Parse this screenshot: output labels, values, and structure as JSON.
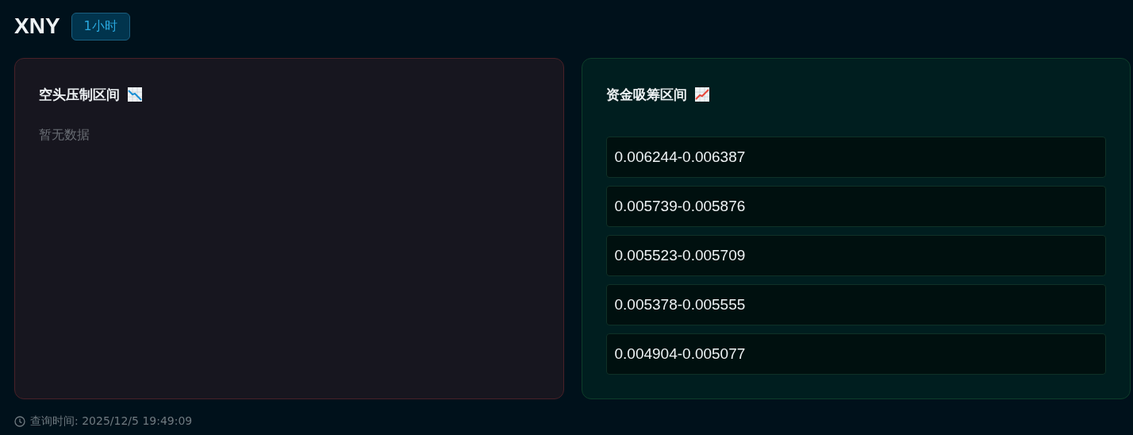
{
  "header": {
    "symbol": "XNY",
    "timeframe": "1小时"
  },
  "panels": [
    {
      "kind": "bear",
      "title": "空头压制区间",
      "empty_text": "暂无数据"
    },
    {
      "kind": "bull",
      "title": "资金吸筹区间",
      "ranges": [
        "0.006244-0.006387",
        "0.005739-0.005876",
        "0.005523-0.005709",
        "0.005378-0.005555",
        "0.004904-0.005077"
      ]
    }
  ],
  "footer": {
    "query_time": "查询时间: 2025/12/5 19:49:09"
  }
}
